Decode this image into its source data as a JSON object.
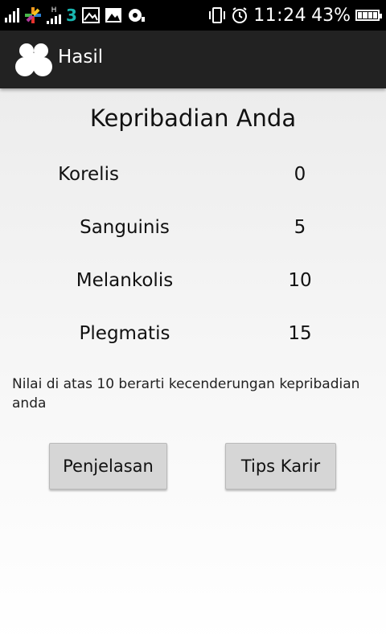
{
  "status_bar": {
    "network_left": "H",
    "network_mid": "H",
    "carrier_badge": "3",
    "time": "11:24",
    "battery_percent": "43%",
    "icons": [
      "signal-icon",
      "star-icon",
      "signal-icon",
      "carrier-3-icon",
      "image-icon",
      "image-icon",
      "record-icon",
      "vibrate-icon",
      "alarm-icon",
      "battery-icon"
    ]
  },
  "action_bar": {
    "title": "Hasil",
    "icon": "people-icon"
  },
  "main": {
    "heading": "Kepribadian Anda",
    "results": [
      {
        "label": "Korelis",
        "value": "0"
      },
      {
        "label": "Sanguinis",
        "value": "5"
      },
      {
        "label": "Melankolis",
        "value": "10"
      },
      {
        "label": "Plegmatis",
        "value": "15"
      }
    ],
    "note": "Nilai di atas 10 berarti kecenderungan kepribadian anda",
    "buttons": {
      "explanation": "Penjelasan",
      "career_tips": "Tips Karir"
    }
  },
  "colors": {
    "status_bar_bg": "#000000",
    "action_bar_bg": "#222222",
    "carrier_accent": "#19b6b0",
    "button_bg": "#d6d6d6"
  }
}
